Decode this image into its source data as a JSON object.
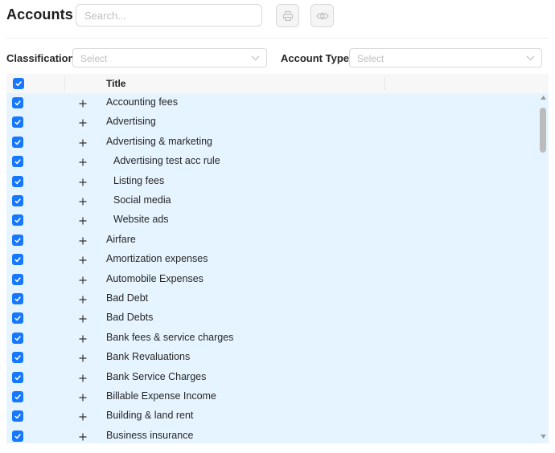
{
  "header": {
    "title": "Accounts",
    "search_placeholder": "Search..."
  },
  "filters": {
    "classification_label": "Classification",
    "classification_placeholder": "Select",
    "account_type_label": "Account Type",
    "account_type_placeholder": "Select"
  },
  "table": {
    "column_title": "Title",
    "rows": [
      {
        "title": "Accounting fees",
        "child": false
      },
      {
        "title": "Advertising",
        "child": false
      },
      {
        "title": "Advertising & marketing",
        "child": false
      },
      {
        "title": "Advertising test acc rule",
        "child": true
      },
      {
        "title": "Listing fees",
        "child": true
      },
      {
        "title": "Social media",
        "child": true
      },
      {
        "title": "Website ads",
        "child": true
      },
      {
        "title": "Airfare",
        "child": false
      },
      {
        "title": "Amortization expenses",
        "child": false
      },
      {
        "title": "Automobile Expenses",
        "child": false
      },
      {
        "title": "Bad Debt",
        "child": false
      },
      {
        "title": "Bad Debts",
        "child": false
      },
      {
        "title": "Bank fees & service charges",
        "child": false
      },
      {
        "title": "Bank Revaluations",
        "child": false
      },
      {
        "title": "Bank Service Charges",
        "child": false
      },
      {
        "title": "Billable Expense Income",
        "child": false
      },
      {
        "title": "Building & land rent",
        "child": false
      },
      {
        "title": "Business insurance",
        "child": false
      }
    ]
  },
  "colors": {
    "accent": "#1677ff",
    "selected_row_bg": "#e6f4ff"
  },
  "icons": {
    "print_button": "printer-icon",
    "view_button": "eye-icon",
    "expand": "plus-icon"
  }
}
